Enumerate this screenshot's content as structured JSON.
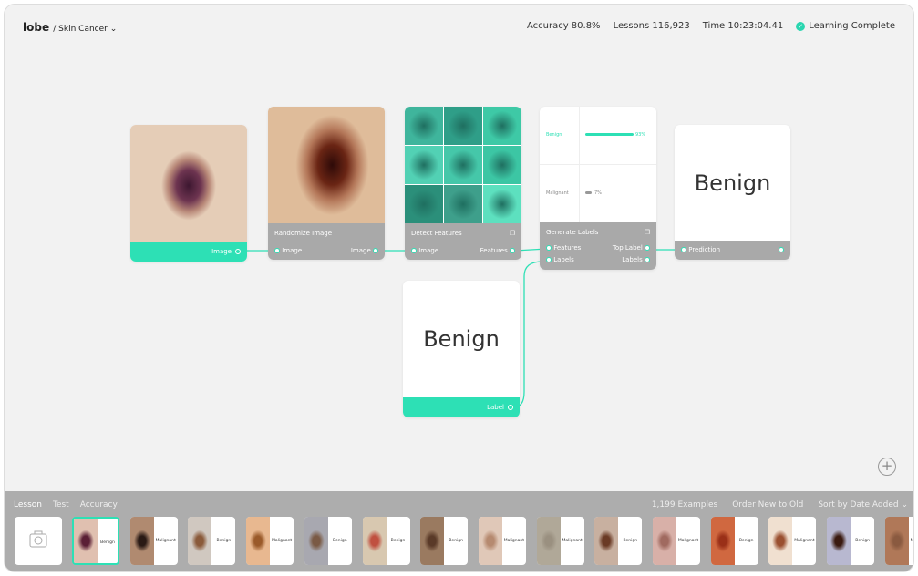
{
  "header": {
    "logo": "lobe",
    "project": "/ Skin Cancer",
    "accuracy": "Accuracy 80.8%",
    "lessons": "Lessons 116,923",
    "time": "Time 10:23:04.41",
    "status": "Learning Complete"
  },
  "nodes": {
    "image": {
      "port_out": "Image"
    },
    "randomize": {
      "title": "Randomize Image",
      "port_in": "Image",
      "port_out": "Image"
    },
    "detect": {
      "title": "Detect Features",
      "port_in": "Image",
      "port_out": "Features"
    },
    "generate": {
      "title": "Generate Labels",
      "port_in1": "Features",
      "port_in2": "Labels",
      "port_out1": "Top Label",
      "port_out2": "Labels",
      "labels": [
        {
          "name": "Benign",
          "pct": "93%",
          "value": 93
        },
        {
          "name": "Malignant",
          "pct": "7%",
          "value": 7
        }
      ]
    },
    "prediction": {
      "value": "Benign",
      "port_in": "Prediction"
    },
    "label": {
      "value": "Benign",
      "port_out": "Label"
    }
  },
  "colors": {
    "accent": "#2de0b5"
  },
  "bottom": {
    "tabs": [
      "Lesson",
      "Test",
      "Accuracy"
    ],
    "examples": "1,199 Examples",
    "order": "Order New to Old",
    "sort": "Sort by Date Added ⌄",
    "thumbs": [
      "Benign",
      "Malignant",
      "Benign",
      "Malignant",
      "Benign",
      "Benign",
      "Benign",
      "Malignant",
      "Malignant",
      "Benign",
      "Malignant",
      "Benign",
      "Malignant",
      "Benign",
      "Malignant"
    ]
  }
}
